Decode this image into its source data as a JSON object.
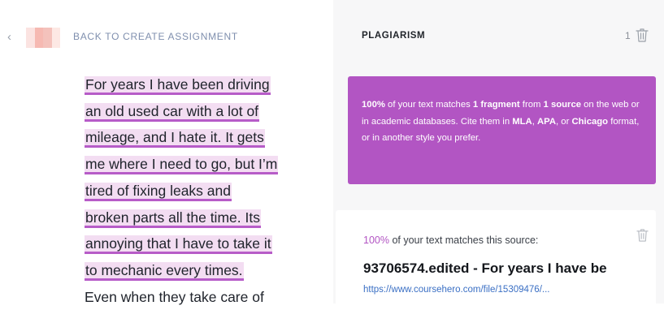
{
  "colors": {
    "highlight_fill": "#f3ddf2",
    "highlight_underline": "#b75cc8",
    "summary_card": "#b255c3",
    "link": "#3a6fc4",
    "back_link": "#7f8fae",
    "avatar_blur": [
      "#fbe3e1",
      "#f6b9b2",
      "#f4c2bc",
      "#fde8e4"
    ]
  },
  "header": {
    "back_icon": "chevron-left-icon",
    "back_label": "BACK TO CREATE ASSIGNMENT"
  },
  "essay": {
    "lines": [
      "For years I have been driving",
      "an old used car with a lot of",
      "mileage, and I hate it. It gets",
      "me where I need to go, but I’m",
      "tired of fixing leaks and",
      "broken parts all the time. Its",
      "annoying that I have to take it",
      "to mechanic every times.",
      "Even when they take care of"
    ],
    "highlighted_line_count": 8
  },
  "panel": {
    "title": "PLAGIARISM",
    "match_count": "1",
    "delete_icon": "trash-icon"
  },
  "summary": {
    "pct": "100%",
    "t1": " of your text matches ",
    "fragments": "1 fragment",
    "t2": " from ",
    "sources": "1 source",
    "t3": " on the web or in academic databases. Cite them in ",
    "mla": "MLA",
    "sep1": ", ",
    "apa": "APA",
    "sep2": ", or ",
    "chicago": "Chicago",
    "t4": " format, or in another style you prefer."
  },
  "source": {
    "pct": "100%",
    "pct_text": " of your text matches this source:",
    "title": "93706574.edited - For years I have be",
    "url": "https://www.coursehero.com/file/15309476/...",
    "delete_icon": "trash-icon"
  }
}
